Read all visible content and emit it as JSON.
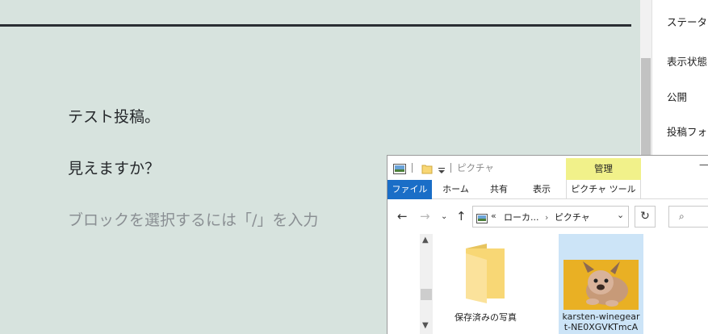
{
  "editor": {
    "paragraph_1": "テスト投稿。",
    "paragraph_2": "見えますか？",
    "placeholder": "ブロックを選択するには「/」を入力"
  },
  "sidebar": {
    "items": [
      {
        "label": "ステータ"
      },
      {
        "label": "表示状態"
      },
      {
        "label": "公開"
      },
      {
        "label": "投稿フォ"
      }
    ]
  },
  "explorer": {
    "title": "ピクチャ",
    "context_tab": "管理",
    "ribbon_tabs": [
      {
        "label": "ファイル"
      },
      {
        "label": "ホーム"
      },
      {
        "label": "共有"
      },
      {
        "label": "表示"
      },
      {
        "label": "ピクチャ ツール"
      }
    ],
    "address": {
      "prefix": "«",
      "crumb_1": "ローカ...",
      "separator": "›",
      "crumb_2": "ピクチャ"
    },
    "items": [
      {
        "name": "保存済みの写真",
        "type": "folder"
      },
      {
        "name": "karsten-winegeart-NE0XGVKTmcA",
        "line_1": "karsten-winegear",
        "line_2": "t-NE0XGVKTmcA",
        "type": "image"
      }
    ]
  },
  "colors": {
    "editor_bg": "#d7e3de",
    "accent_file_tab": "#1a6ec7",
    "manage_tab": "#f1f18a",
    "folder_yellow": "#f8d775"
  }
}
